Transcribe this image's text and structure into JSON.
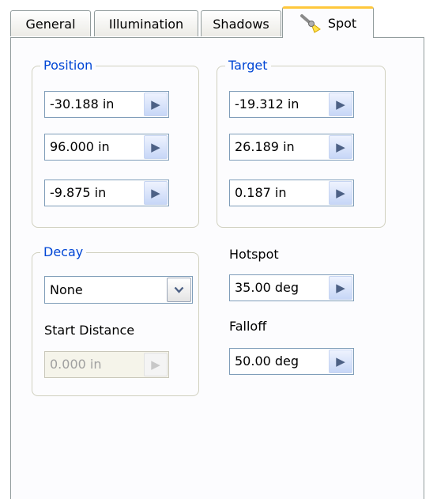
{
  "tabs": [
    {
      "label": "General"
    },
    {
      "label": "Illumination"
    },
    {
      "label": "Shadows"
    },
    {
      "label": "Spot"
    }
  ],
  "position": {
    "title": "Position",
    "fields": [
      {
        "value": "-30.188 in"
      },
      {
        "value": "96.000 in"
      },
      {
        "value": "-9.875 in"
      }
    ]
  },
  "target": {
    "title": "Target",
    "fields": [
      {
        "value": "-19.312 in"
      },
      {
        "value": "26.189 in"
      },
      {
        "value": "0.187 in"
      }
    ]
  },
  "decay": {
    "title": "Decay",
    "selected": "None",
    "start_distance_label": "Start Distance",
    "start_distance_value": "0.000 in"
  },
  "hotspot": {
    "label": "Hotspot",
    "value": "35.00 deg"
  },
  "falloff": {
    "label": "Falloff",
    "value": "50.00 deg"
  },
  "icons": {
    "spot_tab": "spotlight-icon",
    "arrow": "chevron-right-icon",
    "dropdown": "chevron-down-icon"
  },
  "colors": {
    "group_title": "#0046d5",
    "active_tab_highlight": "#ffc83c",
    "field_border": "#7f9db9"
  }
}
